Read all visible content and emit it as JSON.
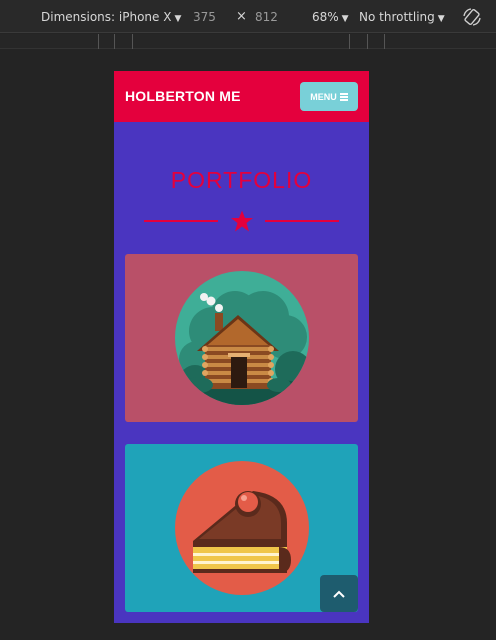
{
  "devtools": {
    "device_label": "Dimensions: iPhone X",
    "width": "375",
    "times": "×",
    "height": "812",
    "zoom": "68%",
    "throttle": "No throttling",
    "rotate_icon": "rotate-icon"
  },
  "site": {
    "brand": "HOLBERTON ME",
    "menu_label": "MENU",
    "section_title": "PORTFOLIO",
    "colors": {
      "header": "#e4003d",
      "body": "#4a35c0",
      "menu_button": "#79d0d8",
      "card_cabin": "#b95068",
      "card_cake": "#1fa3b9",
      "scroll_button": "#1e5c6e"
    },
    "portfolio": [
      {
        "icon": "log-cabin-icon",
        "color": "#b95068"
      },
      {
        "icon": "cake-slice-icon",
        "color": "#1fa3b9"
      }
    ]
  }
}
